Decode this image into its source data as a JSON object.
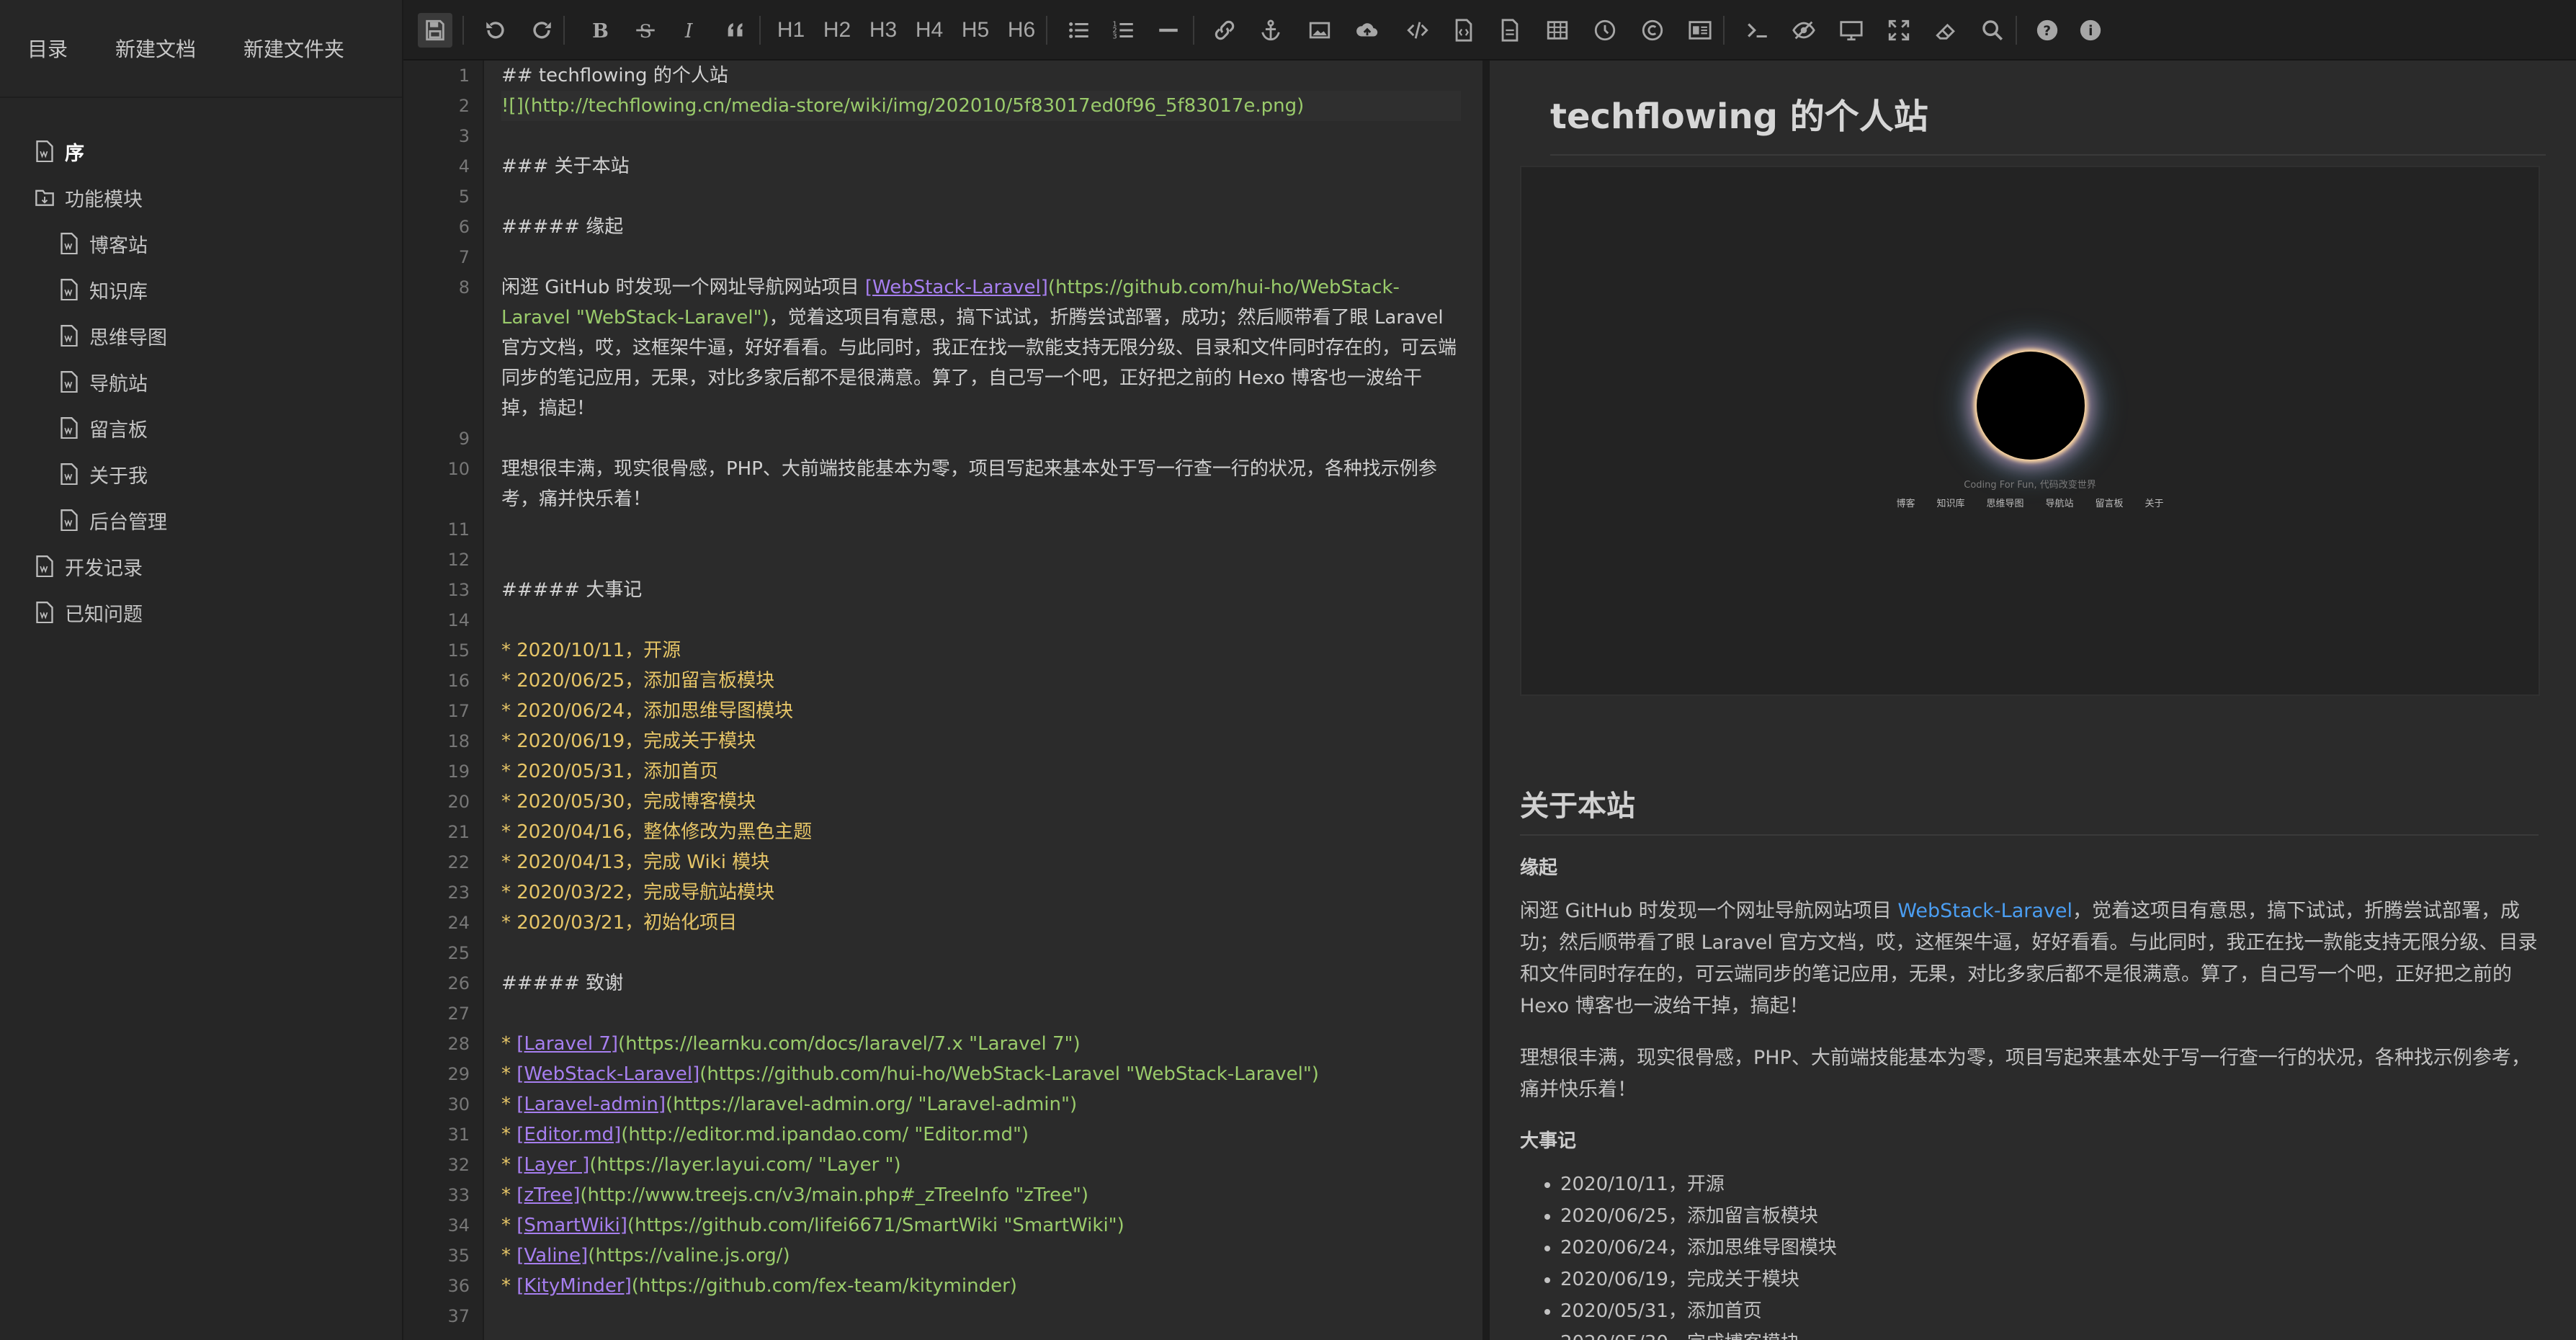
{
  "sidebar": {
    "top": [
      "目录",
      "新建文档",
      "新建文件夹"
    ],
    "tree": [
      {
        "label": "序",
        "level": 0,
        "icon": "file-icon",
        "active": true
      },
      {
        "label": "功能模块",
        "level": 0,
        "icon": "folder-icon"
      },
      {
        "label": "博客站",
        "level": 1,
        "icon": "file-icon"
      },
      {
        "label": "知识库",
        "level": 1,
        "icon": "file-icon"
      },
      {
        "label": "思维导图",
        "level": 1,
        "icon": "file-icon"
      },
      {
        "label": "导航站",
        "level": 1,
        "icon": "file-icon"
      },
      {
        "label": "留言板",
        "level": 1,
        "icon": "file-icon"
      },
      {
        "label": "关于我",
        "level": 1,
        "icon": "file-icon"
      },
      {
        "label": "后台管理",
        "level": 1,
        "icon": "file-icon"
      },
      {
        "label": "开发记录",
        "level": 0,
        "icon": "file-icon"
      },
      {
        "label": "已知问题",
        "level": 0,
        "icon": "file-icon"
      }
    ]
  },
  "toolbar": {
    "headings": [
      "H1",
      "H2",
      "H3",
      "H4",
      "H5",
      "H6"
    ],
    "icons": [
      "save-icon",
      "undo-icon",
      "redo-icon",
      "bold-icon",
      "strikethrough-icon",
      "italic-icon",
      "quote-icon",
      "list-ul-icon",
      "list-ol-icon",
      "hr-icon",
      "link-icon",
      "anchor-icon",
      "image-icon",
      "upload-icon",
      "code-icon",
      "file-code-icon",
      "file-preview-icon",
      "table-icon",
      "clock-icon",
      "copyright-icon",
      "html-entity-icon",
      "terminal-icon",
      "eye-slash-icon",
      "desktop-icon",
      "fullscreen-icon",
      "eraser-icon",
      "search-icon",
      "help-icon",
      "info-icon"
    ]
  },
  "editor": {
    "lines": [
      {
        "n": "1",
        "segs": [
          {
            "t": "## techflowing 的个人站",
            "c": "h"
          }
        ]
      },
      {
        "n": "2",
        "segs": [
          {
            "t": "![](http://techflowing.cn/media-store/wiki/img/202010/5f83017ed0f96_5f83017e.png)",
            "c": "g"
          }
        ]
      },
      {
        "n": "3",
        "segs": []
      },
      {
        "n": "4",
        "segs": [
          {
            "t": "### 关于本站",
            "c": "h"
          }
        ]
      },
      {
        "n": "5",
        "segs": []
      },
      {
        "n": "6",
        "segs": [
          {
            "t": "##### 缘起",
            "c": "h"
          }
        ]
      },
      {
        "n": "7",
        "segs": []
      },
      {
        "n": "8",
        "para": true,
        "segs": [
          {
            "t": "闲逛 GitHub 时发现一个网址导航网站项目 ",
            "c": "p"
          },
          {
            "t": "[WebStack-Laravel]",
            "c": "lk"
          },
          {
            "t": "(https://github.com/hui-ho/WebStack-Laravel \"WebStack-Laravel\")",
            "c": "g"
          },
          {
            "t": "，觉着这项目有意思，搞下试试，折腾尝试部署，成功；然后顺带看了眼 Laravel 官方文档，哎，这框架牛逼，好好看看。与此同时，我正在找一款能支持无限分级、目录和文件同时存在的，可云端同步的笔记应用，无果，对比多家后都不是很满意。算了，自己写一个吧，正好把之前的 Hexo 博客也一波给干掉，搞起！",
            "c": "p"
          }
        ]
      },
      {
        "n": "9",
        "segs": []
      },
      {
        "n": "10",
        "para": true,
        "segs": [
          {
            "t": "理想很丰满，现实很骨感，PHP、大前端技能基本为零，项目写起来基本处于写一行查一行的状况，各种找示例参考，痛并快乐着！",
            "c": "p"
          }
        ]
      },
      {
        "n": "11",
        "segs": []
      },
      {
        "n": "12",
        "segs": []
      },
      {
        "n": "13",
        "segs": [
          {
            "t": "##### 大事记",
            "c": "h"
          }
        ]
      },
      {
        "n": "14",
        "segs": []
      },
      {
        "n": "15",
        "segs": [
          {
            "t": "* 2020/10/11，开源",
            "c": "y"
          }
        ]
      },
      {
        "n": "16",
        "segs": [
          {
            "t": "* 2020/06/25，添加留言板模块",
            "c": "y"
          }
        ]
      },
      {
        "n": "17",
        "segs": [
          {
            "t": "* 2020/06/24，添加思维导图模块",
            "c": "y"
          }
        ]
      },
      {
        "n": "18",
        "segs": [
          {
            "t": "* 2020/06/19，完成关于模块",
            "c": "y"
          }
        ]
      },
      {
        "n": "19",
        "segs": [
          {
            "t": "* 2020/05/31，添加首页",
            "c": "y"
          }
        ]
      },
      {
        "n": "20",
        "segs": [
          {
            "t": "* 2020/05/30，完成博客模块",
            "c": "y"
          }
        ]
      },
      {
        "n": "21",
        "segs": [
          {
            "t": "* 2020/04/16，整体修改为黑色主题",
            "c": "y"
          }
        ]
      },
      {
        "n": "22",
        "segs": [
          {
            "t": "* 2020/04/13，完成 Wiki 模块",
            "c": "y"
          }
        ]
      },
      {
        "n": "23",
        "segs": [
          {
            "t": "* 2020/03/22，完成导航站模块",
            "c": "y"
          }
        ]
      },
      {
        "n": "24",
        "segs": [
          {
            "t": "* 2020/03/21，初始化项目",
            "c": "y"
          }
        ]
      },
      {
        "n": "25",
        "segs": []
      },
      {
        "n": "26",
        "segs": [
          {
            "t": "##### 致谢",
            "c": "h"
          }
        ]
      },
      {
        "n": "27",
        "segs": []
      },
      {
        "n": "28",
        "segs": [
          {
            "t": "* ",
            "c": "y"
          },
          {
            "t": "[Laravel 7]",
            "c": "lk"
          },
          {
            "t": "(https://learnku.com/docs/laravel/7.x \"Laravel 7\")",
            "c": "g"
          }
        ]
      },
      {
        "n": "29",
        "segs": [
          {
            "t": "* ",
            "c": "y"
          },
          {
            "t": "[WebStack-Laravel]",
            "c": "lk"
          },
          {
            "t": "(https://github.com/hui-ho/WebStack-Laravel \"WebStack-Laravel\")",
            "c": "g"
          }
        ]
      },
      {
        "n": "30",
        "segs": [
          {
            "t": "* ",
            "c": "y"
          },
          {
            "t": "[Laravel-admin]",
            "c": "lk"
          },
          {
            "t": "(https://laravel-admin.org/ \"Laravel-admin\")",
            "c": "g"
          }
        ]
      },
      {
        "n": "31",
        "segs": [
          {
            "t": "* ",
            "c": "y"
          },
          {
            "t": "[Editor.md]",
            "c": "lk"
          },
          {
            "t": "(http://editor.md.ipandao.com/ \"Editor.md\")",
            "c": "g"
          }
        ]
      },
      {
        "n": "32",
        "segs": [
          {
            "t": "* ",
            "c": "y"
          },
          {
            "t": "[Layer ]",
            "c": "lk"
          },
          {
            "t": "(https://layer.layui.com/ \"Layer \")",
            "c": "g"
          }
        ]
      },
      {
        "n": "33",
        "segs": [
          {
            "t": "* ",
            "c": "y"
          },
          {
            "t": "[zTree]",
            "c": "lk"
          },
          {
            "t": "(http://www.treejs.cn/v3/main.php#_zTreeInfo \"zTree\")",
            "c": "g"
          }
        ]
      },
      {
        "n": "34",
        "segs": [
          {
            "t": "* ",
            "c": "y"
          },
          {
            "t": "[SmartWiki]",
            "c": "lk"
          },
          {
            "t": "(https://github.com/lifei6671/SmartWiki \"SmartWiki\")",
            "c": "g"
          }
        ]
      },
      {
        "n": "35",
        "segs": [
          {
            "t": "* ",
            "c": "y"
          },
          {
            "t": "[Valine]",
            "c": "lk"
          },
          {
            "t": "(https://valine.js.org/)",
            "c": "g"
          }
        ]
      },
      {
        "n": "36",
        "segs": [
          {
            "t": "* ",
            "c": "y"
          },
          {
            "t": "[KityMinder]",
            "c": "lk"
          },
          {
            "t": "(https://github.com/fex-team/kityminder)",
            "c": "g"
          }
        ]
      },
      {
        "n": "37",
        "segs": []
      }
    ]
  },
  "preview": {
    "title": "techflowing 的个人站",
    "image": {
      "caption": "Coding For Fun, 代码改变世界",
      "nav": [
        "博客",
        "知识库",
        "思维导图",
        "导航站",
        "留言板",
        "关于"
      ]
    },
    "h3": "关于本站",
    "origin_heading": "缘起",
    "origin_p1_before": "闲逛 GitHub 时发现一个网址导航网站项目 ",
    "origin_p1_link": "WebStack-Laravel",
    "origin_p1_after": "，觉着这项目有意思，搞下试试，折腾尝试部署，成功；然后顺带看了眼 Laravel 官方文档，哎，这框架牛逼，好好看看。与此同时，我正在找一款能支持无限分级、目录和文件同时存在的，可云端同步的笔记应用，无果，对比多家后都不是很满意。算了，自己写一个吧，正好把之前的 Hexo 博客也一波给干掉，搞起！",
    "origin_p2": "理想很丰满，现实很骨感，PHP、大前端技能基本为零，项目写起来基本处于写一行查一行的状况，各种找示例参考，痛并快乐着！",
    "events_heading": "大事记",
    "events": [
      "2020/10/11，开源",
      "2020/06/25，添加留言板模块",
      "2020/06/24，添加思维导图模块",
      "2020/06/19，完成关于模块",
      "2020/05/31，添加首页",
      "2020/05/30，完成博客模块",
      "2020/04/16，整体修改为黑色主题"
    ]
  },
  "colors": {
    "background": "#2b2b2b",
    "sidebar": "#262626",
    "toolbar": "#1f1f1f",
    "link": "#a77ff0",
    "url": "#9acb6b",
    "list": "#e6c567",
    "preview_link": "#4b9ef2"
  }
}
